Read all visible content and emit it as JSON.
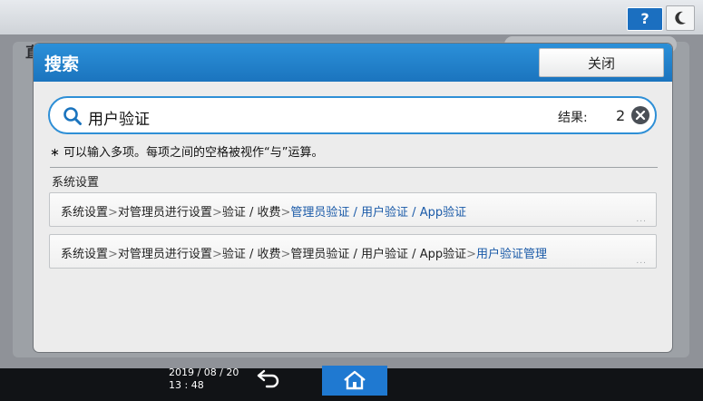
{
  "background": {
    "left_char": "直"
  },
  "top_bar": {
    "help_label": "?"
  },
  "dialog": {
    "title": "搜索",
    "close_label": "关闭",
    "search": {
      "value": "用户验证",
      "results_label": "结果:",
      "results_count": "2"
    },
    "hint": "∗ 可以输入多项。每项之间的空格被视作“与”运算。",
    "section_title": "系统设置",
    "results": [
      {
        "segments": [
          {
            "text": "系统设置",
            "link": false
          },
          {
            "text": ">",
            "sep": true
          },
          {
            "text": "对管理员进行设置",
            "link": false
          },
          {
            "text": ">",
            "sep": true
          },
          {
            "text": "验证 / 收费",
            "link": false
          },
          {
            "text": ">",
            "sep": true
          },
          {
            "text": "管理员验证 / 用户验证 / App验证",
            "link": true
          }
        ]
      },
      {
        "segments": [
          {
            "text": "系统设置",
            "link": false
          },
          {
            "text": ">",
            "sep": true
          },
          {
            "text": "对管理员进行设置",
            "link": false
          },
          {
            "text": ">",
            "sep": true
          },
          {
            "text": "验证 / 收费",
            "link": false
          },
          {
            "text": ">",
            "sep": true
          },
          {
            "text": "管理员验证 / 用户验证 / App验证",
            "link": false
          },
          {
            "text": ">",
            "sep": true
          },
          {
            "text": "用户验证管理",
            "link": true
          }
        ]
      }
    ]
  },
  "bottom_bar": {
    "date": "2019 / 08 / 20",
    "time": "13 : 48"
  },
  "colors": {
    "header_blue": "#1b74be",
    "link_blue": "#1a5aa8",
    "home_blue": "#1f79d1"
  }
}
